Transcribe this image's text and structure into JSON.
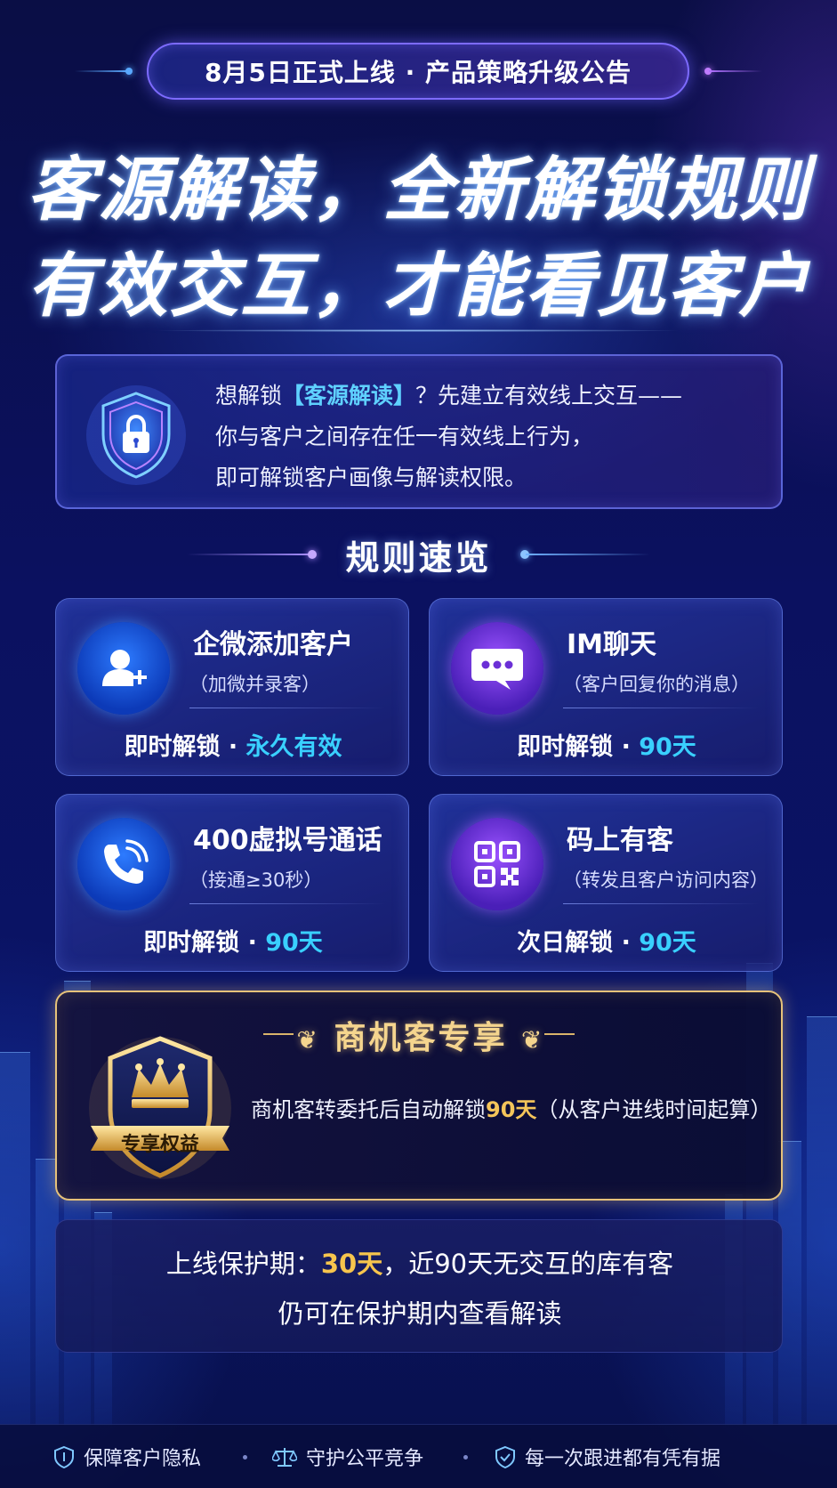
{
  "announcement": {
    "label": "8月5日正式上线 · 产品策略升级公告"
  },
  "headline": {
    "line1": "客源解读，全新解锁规则",
    "line2": "有效交互，才能看见客户"
  },
  "intro": {
    "icon": "shield-lock-icon",
    "line1_pre": "想解锁",
    "line1_highlight": "【客源解读】",
    "line1_post": "？先建立有效线上交互——",
    "line2": "你与客户之间存在任一有效线上行为，",
    "line3": "即可解锁客户画像与解读权限。"
  },
  "rules": {
    "title": "规则速览",
    "cards": [
      {
        "icon": "user-add-icon",
        "title": "企微添加客户",
        "subtitle": "（加微并录客）",
        "unlock": "即时解锁 · ",
        "duration": "永久有效"
      },
      {
        "icon": "chat-bubble-icon",
        "title": "IM聊天",
        "subtitle": "（客户回复你的消息）",
        "unlock": "即时解锁 · ",
        "duration": "90天"
      },
      {
        "icon": "phone-call-icon",
        "title": "400虚拟号通话",
        "subtitle": "（接通≥30秒）",
        "unlock": "即时解锁 · ",
        "duration": "90天"
      },
      {
        "icon": "qr-code-icon",
        "title": "码上有客",
        "subtitle": "（转发且客户访问内容）",
        "unlock": "次日解锁 · ",
        "duration": "90天"
      }
    ]
  },
  "premium": {
    "title": "商机客专享",
    "badge_icon": "crown-icon",
    "badge_label": "专享权益",
    "text_pre": "商机客转委托后自动解锁",
    "text_highlight": "90天",
    "text_post": "（从客户进线时间起算）"
  },
  "protection": {
    "line1_pre": "上线保护期：",
    "line1_highlight": "30天",
    "line1_post": "，近90天无交互的库有客",
    "line2": "仍可在保护期内查看解读"
  },
  "footer": {
    "items": [
      {
        "icon": "shield-icon",
        "label": "保障客户隐私"
      },
      {
        "icon": "scale-icon",
        "label": "守护公平竞争"
      },
      {
        "icon": "shield-check-icon",
        "label": "每一次跟进都有凭有据"
      }
    ]
  },
  "colors": {
    "accent_cyan": "#39d0ff",
    "gold": "#f5c55a",
    "background": "#0a0e45"
  }
}
